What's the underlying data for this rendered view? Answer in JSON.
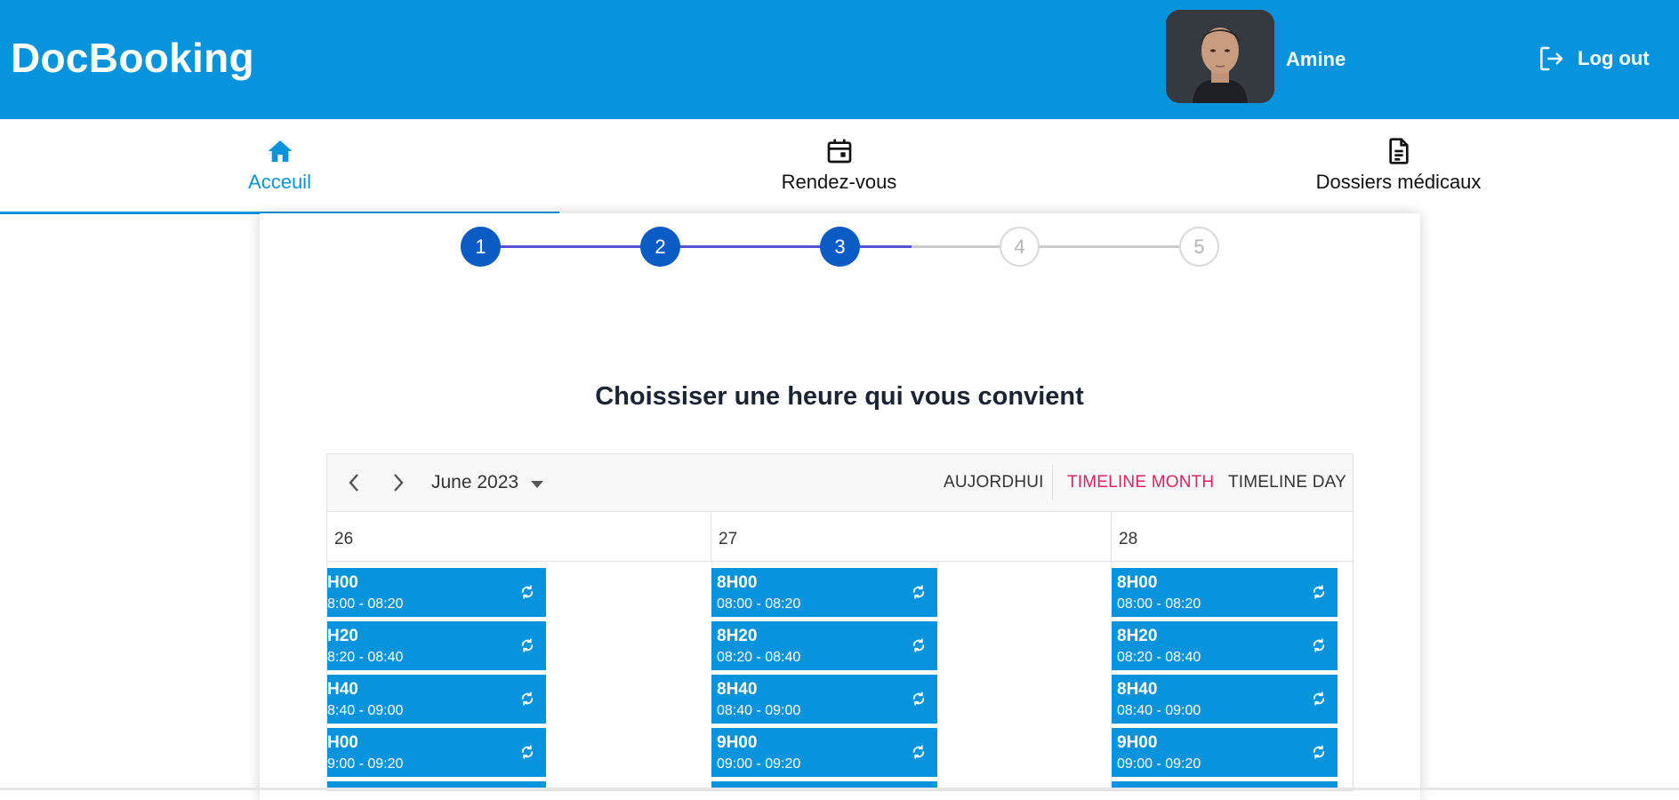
{
  "app": {
    "title": "DocBooking"
  },
  "user": {
    "name": "Amine",
    "logout_label": "Log out"
  },
  "tabs": [
    {
      "label": "Acceuil",
      "icon": "home-icon",
      "active": true
    },
    {
      "label": "Rendez-vous",
      "icon": "calendar-icon",
      "active": false
    },
    {
      "label": "Dossiers médicaux",
      "icon": "document-icon",
      "active": false
    }
  ],
  "stepper": {
    "steps": [
      "1",
      "2",
      "3",
      "4",
      "5"
    ],
    "current": 3
  },
  "page": {
    "heading": "Choissiser une heure qui vous convient"
  },
  "scheduler": {
    "month_label": "June 2023",
    "buttons": {
      "today": "AUJORDHUI",
      "timeline_month": "TIMELINE MONTH",
      "timeline_day": "TIMELINE DAY"
    },
    "active_view": "TIMELINE MONTH",
    "days": [
      {
        "label": "26",
        "slots": [
          {
            "title": "H00",
            "range": "8:00 - 08:20"
          },
          {
            "title": "H20",
            "range": "8:20 - 08:40"
          },
          {
            "title": "H40",
            "range": "8:40 - 09:00"
          },
          {
            "title": "H00",
            "range": "9:00 - 09:20"
          }
        ]
      },
      {
        "label": "27",
        "slots": [
          {
            "title": "8H00",
            "range": "08:00 - 08:20"
          },
          {
            "title": "8H20",
            "range": "08:20 - 08:40"
          },
          {
            "title": "8H40",
            "range": "08:40 - 09:00"
          },
          {
            "title": "9H00",
            "range": "09:00 - 09:20"
          }
        ]
      },
      {
        "label": "28",
        "slots": [
          {
            "title": "8H00",
            "range": "08:00 - 08:20"
          },
          {
            "title": "8H20",
            "range": "08:20 - 08:40"
          },
          {
            "title": "8H40",
            "range": "08:40 - 09:00"
          },
          {
            "title": "9H00",
            "range": "09:00 - 09:20"
          }
        ]
      }
    ]
  },
  "colors": {
    "header": "#0794dc",
    "step_done": "#0a5bc3",
    "step_line_done": "#5b4fd1",
    "active_view": "#e0215f"
  }
}
